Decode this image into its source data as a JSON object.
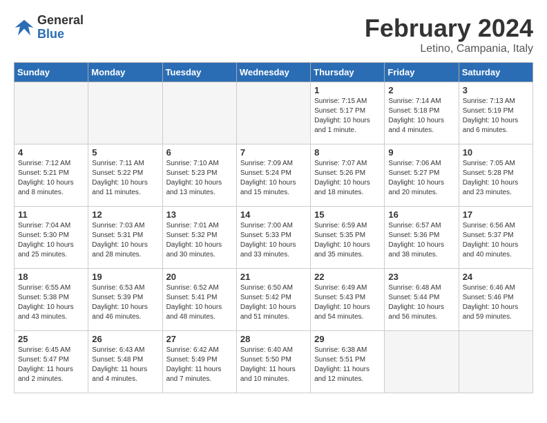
{
  "header": {
    "logo_line1": "General",
    "logo_line2": "Blue",
    "title": "February 2024",
    "subtitle": "Letino, Campania, Italy"
  },
  "weekdays": [
    "Sunday",
    "Monday",
    "Tuesday",
    "Wednesday",
    "Thursday",
    "Friday",
    "Saturday"
  ],
  "weeks": [
    [
      {
        "day": "",
        "empty": true
      },
      {
        "day": "",
        "empty": true
      },
      {
        "day": "",
        "empty": true
      },
      {
        "day": "",
        "empty": true
      },
      {
        "day": "1",
        "sunrise": "Sunrise: 7:15 AM",
        "sunset": "Sunset: 5:17 PM",
        "daylight": "Daylight: 10 hours and 1 minute."
      },
      {
        "day": "2",
        "sunrise": "Sunrise: 7:14 AM",
        "sunset": "Sunset: 5:18 PM",
        "daylight": "Daylight: 10 hours and 4 minutes."
      },
      {
        "day": "3",
        "sunrise": "Sunrise: 7:13 AM",
        "sunset": "Sunset: 5:19 PM",
        "daylight": "Daylight: 10 hours and 6 minutes."
      }
    ],
    [
      {
        "day": "4",
        "sunrise": "Sunrise: 7:12 AM",
        "sunset": "Sunset: 5:21 PM",
        "daylight": "Daylight: 10 hours and 8 minutes."
      },
      {
        "day": "5",
        "sunrise": "Sunrise: 7:11 AM",
        "sunset": "Sunset: 5:22 PM",
        "daylight": "Daylight: 10 hours and 11 minutes."
      },
      {
        "day": "6",
        "sunrise": "Sunrise: 7:10 AM",
        "sunset": "Sunset: 5:23 PM",
        "daylight": "Daylight: 10 hours and 13 minutes."
      },
      {
        "day": "7",
        "sunrise": "Sunrise: 7:09 AM",
        "sunset": "Sunset: 5:24 PM",
        "daylight": "Daylight: 10 hours and 15 minutes."
      },
      {
        "day": "8",
        "sunrise": "Sunrise: 7:07 AM",
        "sunset": "Sunset: 5:26 PM",
        "daylight": "Daylight: 10 hours and 18 minutes."
      },
      {
        "day": "9",
        "sunrise": "Sunrise: 7:06 AM",
        "sunset": "Sunset: 5:27 PM",
        "daylight": "Daylight: 10 hours and 20 minutes."
      },
      {
        "day": "10",
        "sunrise": "Sunrise: 7:05 AM",
        "sunset": "Sunset: 5:28 PM",
        "daylight": "Daylight: 10 hours and 23 minutes."
      }
    ],
    [
      {
        "day": "11",
        "sunrise": "Sunrise: 7:04 AM",
        "sunset": "Sunset: 5:30 PM",
        "daylight": "Daylight: 10 hours and 25 minutes."
      },
      {
        "day": "12",
        "sunrise": "Sunrise: 7:03 AM",
        "sunset": "Sunset: 5:31 PM",
        "daylight": "Daylight: 10 hours and 28 minutes."
      },
      {
        "day": "13",
        "sunrise": "Sunrise: 7:01 AM",
        "sunset": "Sunset: 5:32 PM",
        "daylight": "Daylight: 10 hours and 30 minutes."
      },
      {
        "day": "14",
        "sunrise": "Sunrise: 7:00 AM",
        "sunset": "Sunset: 5:33 PM",
        "daylight": "Daylight: 10 hours and 33 minutes."
      },
      {
        "day": "15",
        "sunrise": "Sunrise: 6:59 AM",
        "sunset": "Sunset: 5:35 PM",
        "daylight": "Daylight: 10 hours and 35 minutes."
      },
      {
        "day": "16",
        "sunrise": "Sunrise: 6:57 AM",
        "sunset": "Sunset: 5:36 PM",
        "daylight": "Daylight: 10 hours and 38 minutes."
      },
      {
        "day": "17",
        "sunrise": "Sunrise: 6:56 AM",
        "sunset": "Sunset: 5:37 PM",
        "daylight": "Daylight: 10 hours and 40 minutes."
      }
    ],
    [
      {
        "day": "18",
        "sunrise": "Sunrise: 6:55 AM",
        "sunset": "Sunset: 5:38 PM",
        "daylight": "Daylight: 10 hours and 43 minutes."
      },
      {
        "day": "19",
        "sunrise": "Sunrise: 6:53 AM",
        "sunset": "Sunset: 5:39 PM",
        "daylight": "Daylight: 10 hours and 46 minutes."
      },
      {
        "day": "20",
        "sunrise": "Sunrise: 6:52 AM",
        "sunset": "Sunset: 5:41 PM",
        "daylight": "Daylight: 10 hours and 48 minutes."
      },
      {
        "day": "21",
        "sunrise": "Sunrise: 6:50 AM",
        "sunset": "Sunset: 5:42 PM",
        "daylight": "Daylight: 10 hours and 51 minutes."
      },
      {
        "day": "22",
        "sunrise": "Sunrise: 6:49 AM",
        "sunset": "Sunset: 5:43 PM",
        "daylight": "Daylight: 10 hours and 54 minutes."
      },
      {
        "day": "23",
        "sunrise": "Sunrise: 6:48 AM",
        "sunset": "Sunset: 5:44 PM",
        "daylight": "Daylight: 10 hours and 56 minutes."
      },
      {
        "day": "24",
        "sunrise": "Sunrise: 6:46 AM",
        "sunset": "Sunset: 5:46 PM",
        "daylight": "Daylight: 10 hours and 59 minutes."
      }
    ],
    [
      {
        "day": "25",
        "sunrise": "Sunrise: 6:45 AM",
        "sunset": "Sunset: 5:47 PM",
        "daylight": "Daylight: 11 hours and 2 minutes."
      },
      {
        "day": "26",
        "sunrise": "Sunrise: 6:43 AM",
        "sunset": "Sunset: 5:48 PM",
        "daylight": "Daylight: 11 hours and 4 minutes."
      },
      {
        "day": "27",
        "sunrise": "Sunrise: 6:42 AM",
        "sunset": "Sunset: 5:49 PM",
        "daylight": "Daylight: 11 hours and 7 minutes."
      },
      {
        "day": "28",
        "sunrise": "Sunrise: 6:40 AM",
        "sunset": "Sunset: 5:50 PM",
        "daylight": "Daylight: 11 hours and 10 minutes."
      },
      {
        "day": "29",
        "sunrise": "Sunrise: 6:38 AM",
        "sunset": "Sunset: 5:51 PM",
        "daylight": "Daylight: 11 hours and 12 minutes."
      },
      {
        "day": "",
        "empty": true
      },
      {
        "day": "",
        "empty": true
      }
    ]
  ]
}
